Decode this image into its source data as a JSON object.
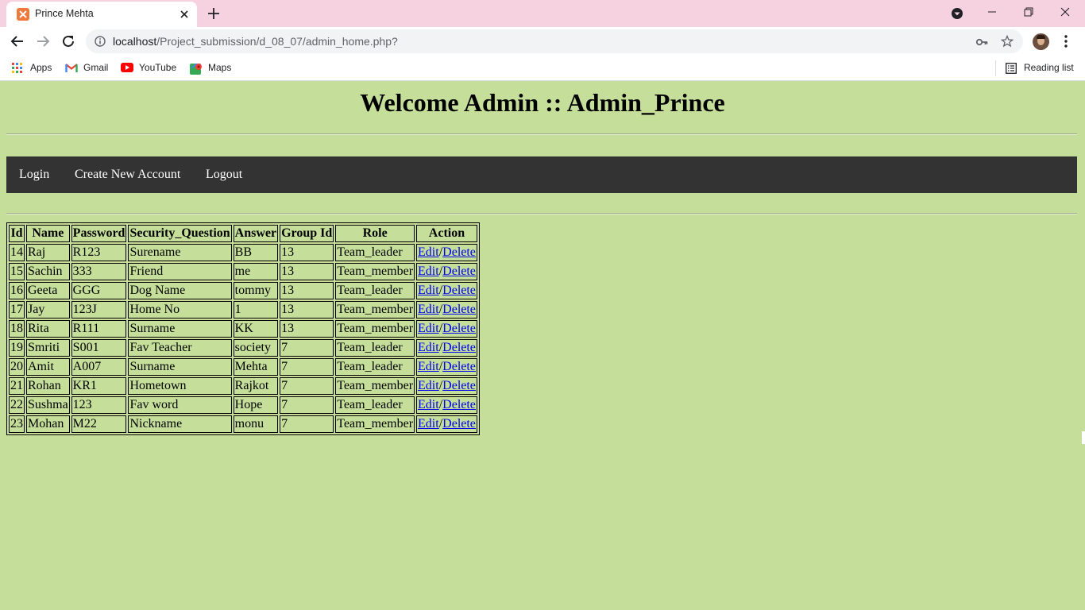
{
  "browser": {
    "tab_title": "Prince Mehta",
    "url_host": "localhost",
    "url_path": "/Project_submission/d_08_07/admin_home.php?",
    "bookmarks": [
      {
        "label": "Apps",
        "icon": "apps-grid-icon"
      },
      {
        "label": "Gmail",
        "icon": "gmail-icon"
      },
      {
        "label": "YouTube",
        "icon": "youtube-icon"
      },
      {
        "label": "Maps",
        "icon": "maps-icon"
      }
    ],
    "reading_list": "Reading list"
  },
  "page": {
    "title": "Welcome Admin :: Admin_Prince",
    "nav": {
      "login": "Login",
      "create_account": "Create New Account",
      "logout": "Logout"
    },
    "table": {
      "headers": [
        "Id",
        "Name",
        "Password",
        "Security_Question",
        "Answer",
        "Group Id",
        "Role",
        "Action"
      ],
      "edit_label": "Edit",
      "separator": "/",
      "delete_label": "Delete",
      "rows": [
        {
          "id": "14",
          "name": "Raj",
          "password": "R123",
          "question": "Surename",
          "answer": "BB",
          "group": "13",
          "role": "Team_leader"
        },
        {
          "id": "15",
          "name": "Sachin",
          "password": "333",
          "question": "Friend",
          "answer": "me",
          "group": "13",
          "role": "Team_member"
        },
        {
          "id": "16",
          "name": "Geeta",
          "password": "GGG",
          "question": "Dog Name",
          "answer": "tommy",
          "group": "13",
          "role": "Team_leader"
        },
        {
          "id": "17",
          "name": "Jay",
          "password": "123J",
          "question": "Home No",
          "answer": "1",
          "group": "13",
          "role": "Team_member"
        },
        {
          "id": "18",
          "name": "Rita",
          "password": "R111",
          "question": "Surname",
          "answer": "KK",
          "group": "13",
          "role": "Team_member"
        },
        {
          "id": "19",
          "name": "Smriti",
          "password": "S001",
          "question": "Fav Teacher",
          "answer": "society",
          "group": "7",
          "role": "Team_leader"
        },
        {
          "id": "20",
          "name": "Amit",
          "password": "A007",
          "question": "Surname",
          "answer": "Mehta",
          "group": "7",
          "role": "Team_leader"
        },
        {
          "id": "21",
          "name": "Rohan",
          "password": "KR1",
          "question": "Hometown",
          "answer": "Rajkot",
          "group": "7",
          "role": "Team_member"
        },
        {
          "id": "22",
          "name": "Sushma",
          "password": "123",
          "question": "Fav word",
          "answer": "Hope",
          "group": "7",
          "role": "Team_leader"
        },
        {
          "id": "23",
          "name": "Mohan",
          "password": "M22",
          "question": "Nickname",
          "answer": "monu",
          "group": "7",
          "role": "Team_member"
        }
      ]
    }
  },
  "colors": {
    "page_background": "#c5df9b",
    "navbar_background": "#333333",
    "link": "#0000ee",
    "tabstrip": "#f6d1e0"
  }
}
